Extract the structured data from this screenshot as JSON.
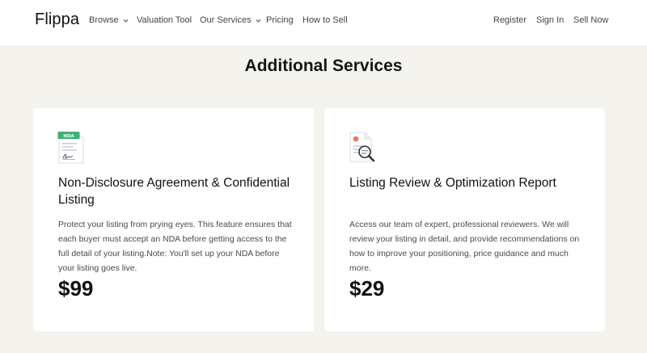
{
  "nav": {
    "logo": "Flippa",
    "left_items": [
      {
        "label": "Browse",
        "has_dropdown": true
      },
      {
        "label": "Valuation Tool",
        "has_dropdown": false
      },
      {
        "label": "Our Services",
        "has_dropdown": true
      },
      {
        "label": "Pricing",
        "has_dropdown": false
      },
      {
        "label": "How to Sell",
        "has_dropdown": false
      }
    ],
    "right_items": [
      {
        "label": "Register"
      },
      {
        "label": "Sign In"
      },
      {
        "label": "Sell Now"
      }
    ]
  },
  "main": {
    "title": "Additional Services",
    "cards": [
      {
        "icon": "nda-document-icon",
        "icon_tag": "NDA",
        "title": "Non-Disclosure Agreement & Confidential Listing",
        "description": "Protect your listing from prying eyes. This feature ensures that each buyer must accept an NDA before getting access to the full detail of your listing.Note: You'll set up your NDA before your listing goes live.",
        "price": "$99"
      },
      {
        "icon": "document-magnifier-icon",
        "title": "Listing Review & Optimization Report",
        "description": "Access our team of expert, professional reviewers. We will review your listing in detail, and provide recommendations on how to improve your positioning, price guidance and much more.",
        "price": "$29"
      }
    ]
  },
  "colors": {
    "page_background": "#f4f3ee",
    "card_background": "#ffffff",
    "nda_badge": "#3bb273",
    "report_dot": "#f0765a"
  }
}
